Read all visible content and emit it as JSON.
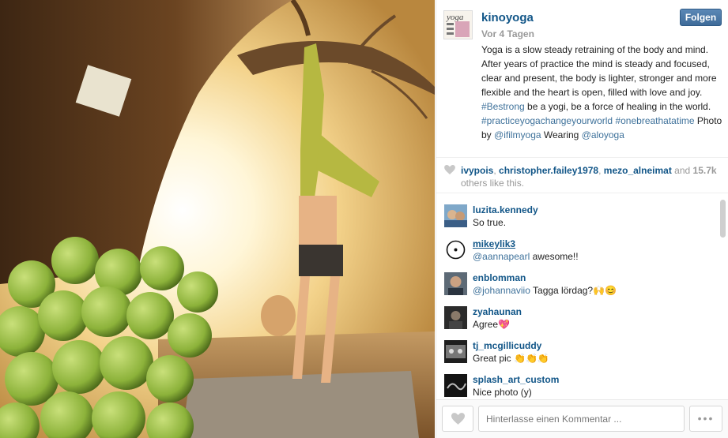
{
  "post": {
    "username": "kinoyoga",
    "time": "Vor 4 Tagen",
    "follow_label": "Folgen",
    "caption": {
      "text1": "Yoga is a slow steady retraining of the body and mind. After years of practice the mind is steady and focused, clear and present, the body is lighter, stronger and more flexible and the heart is open, filled with love and joy. ",
      "tag1": "#Bestrong",
      "text2": " be a yogi, be a force of healing in the world. ",
      "tag2": "#practiceyogachangeyourworld",
      "tag3": "#onebreathatatime",
      "text3": " Photo by ",
      "tag4": "@ifilmyoga",
      "text4": " Wearing ",
      "tag5": "@aloyoga"
    },
    "avatar_icon": "yoga-magazine-avatar"
  },
  "likes": {
    "users": [
      "ivypois",
      "christopher.failey1978",
      "mezo_alneimat"
    ],
    "sep": ", ",
    "and_label": " and ",
    "count": "15.7k",
    "suffix": "others like this."
  },
  "comments": [
    {
      "user": "luzita.kennedy",
      "text": "So true.",
      "mention": ""
    },
    {
      "user": "mikeylik3",
      "mention": "@aannapearl",
      "text": " awesome!!"
    },
    {
      "user": "enblomman",
      "mention": "@johannaviio",
      "text": " Tagga lördag?🙌😊"
    },
    {
      "user": "zyahaunan",
      "mention": "",
      "text": "Agree💖"
    },
    {
      "user": "tj_mcgillicuddy",
      "mention": "",
      "text": "Great pic 👏👏👏"
    },
    {
      "user": "splash_art_custom",
      "mention": "",
      "text": "Nice photo (y)"
    }
  ],
  "footer": {
    "comment_placeholder": "Hinterlasse einen Kommentar ...",
    "more_label": "•••"
  },
  "colors": {
    "link": "#125688",
    "hashtag": "#3f729b",
    "muted": "#999999",
    "follow_bg": "#4a77a5"
  }
}
